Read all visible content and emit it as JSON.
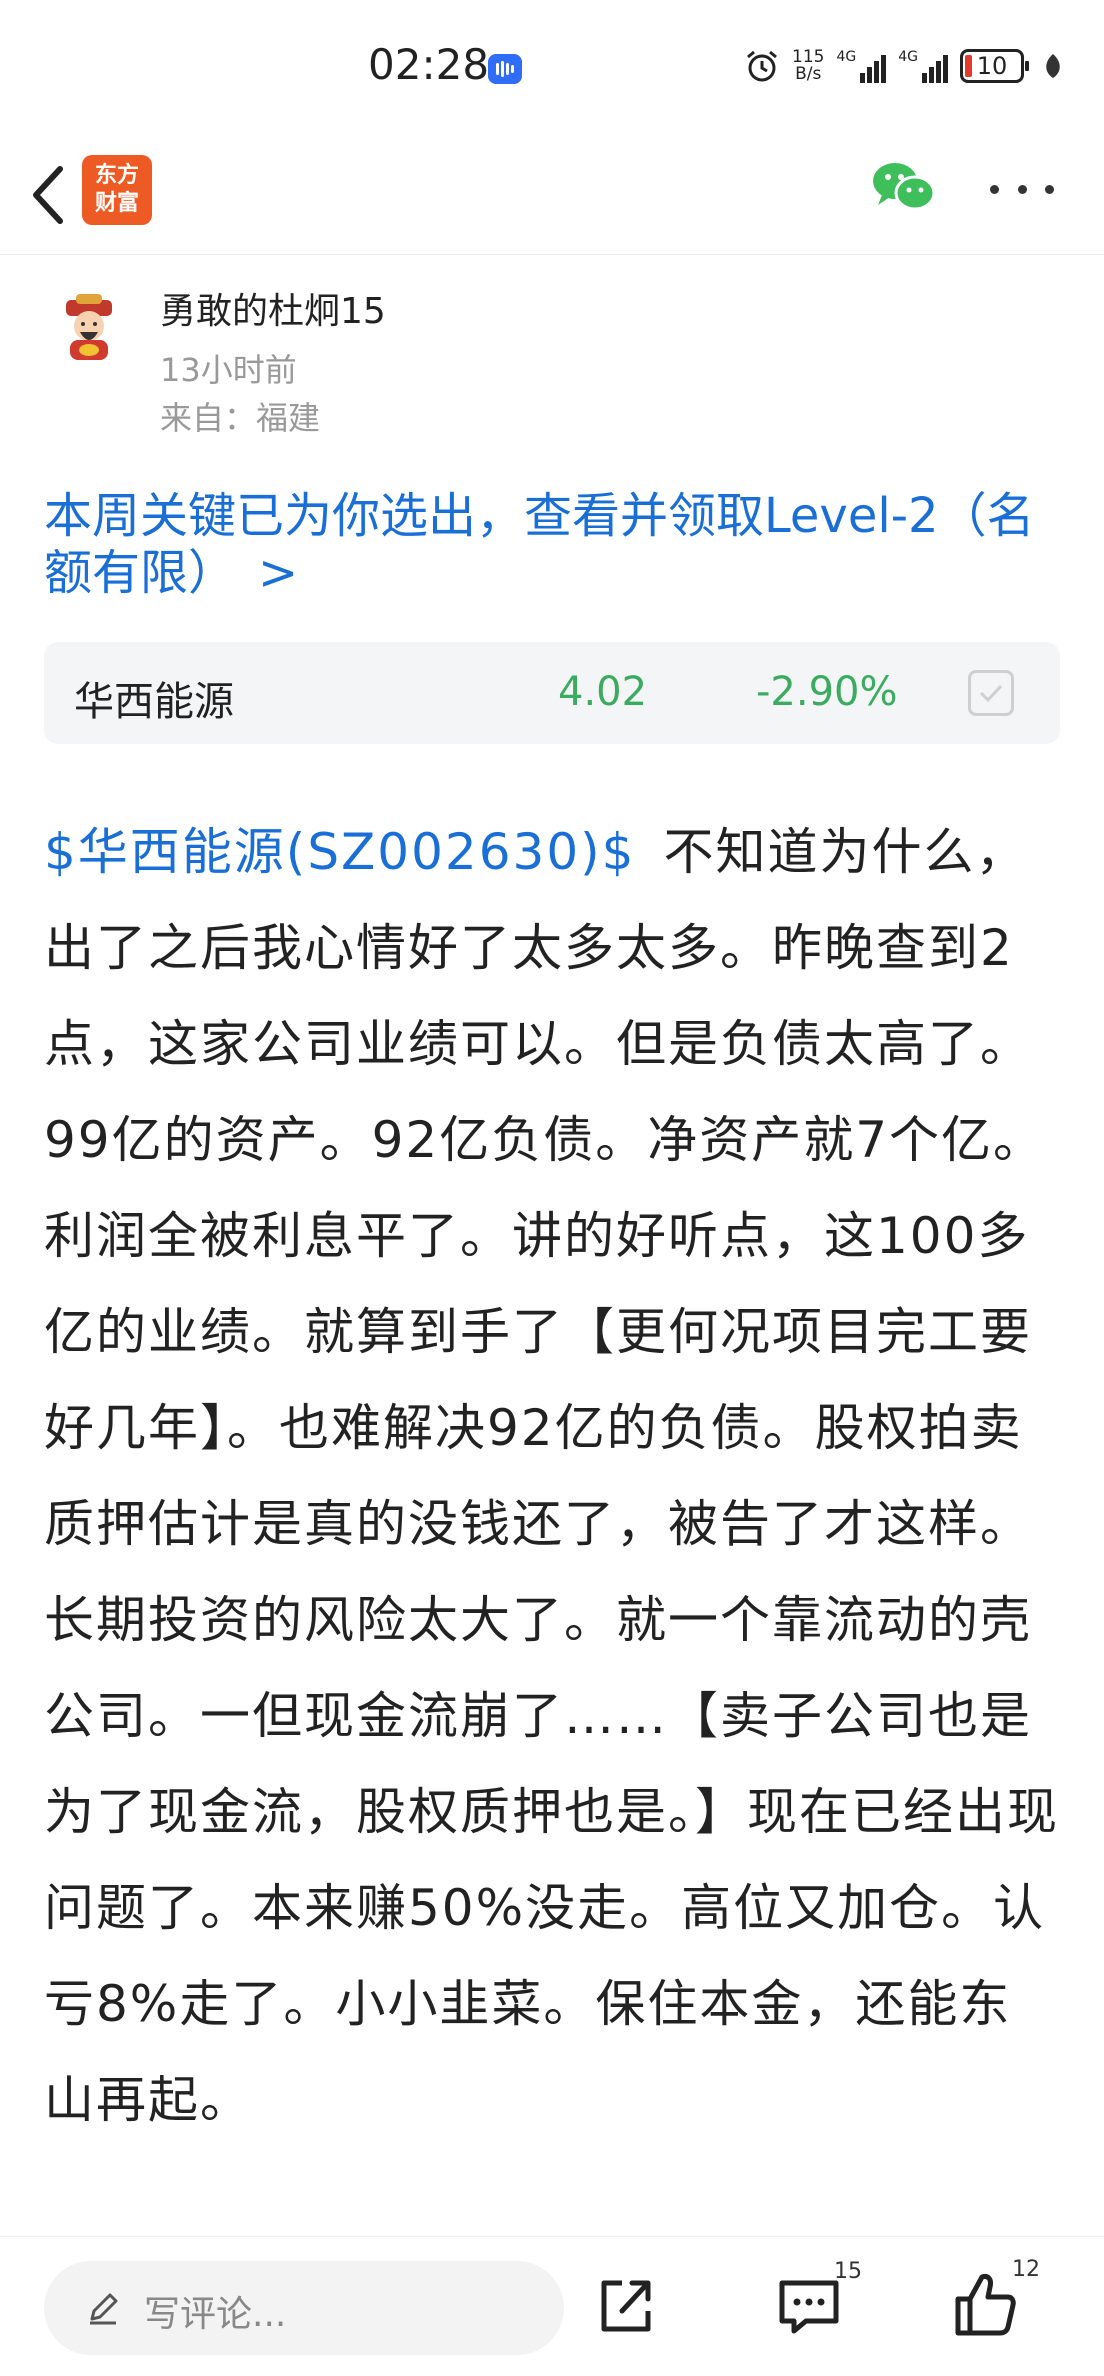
{
  "status_bar": {
    "time": "02:28",
    "net_speed_value": "115",
    "net_speed_unit": "B/s",
    "sim1_label": "4G",
    "sim2_label": "4G",
    "battery": "10"
  },
  "nav": {
    "logo_line1": "东方",
    "logo_line2": "财富",
    "logo_color": "#ee5a24"
  },
  "author": {
    "name": "勇敢的杜炯15",
    "time": "13小时前",
    "location": "来自：福建"
  },
  "promo": {
    "text": "本周关键已为你选出，查看并领取Level-2（名额有限）",
    "arrow": ">",
    "color": "#1a6fd6"
  },
  "stock_card": {
    "name": "华西能源",
    "price": "4.02",
    "change": "-2.90%",
    "change_color": "#3bab5f"
  },
  "post": {
    "stock_link": "$华西能源(SZ002630)$",
    "body": "不知道为什么，出了之后我心情好了太多太多。昨晚查到2点，这家公司业绩可以。但是负债太高了。99亿的资产。92亿负债。净资产就7个亿。利润全被利息平了。讲的好听点，这100多亿的业绩。就算到手了【更何况项目完工要好几年】。也难解决92亿的负债。股权拍卖质押估计是真的没钱还了，被告了才这样。长期投资的风险太大了。就一个靠流动的壳公司。一但现金流崩了……【卖子公司也是为了现金流，股权质押也是。】现在已经出现问题了。本来赚50%没走。高位又加仓。认亏8%走了。小小韭菜。保住本金，还能东山再起。"
  },
  "bottom_bar": {
    "comment_placeholder": "写评论...",
    "comment_count": "15",
    "like_count": "12"
  }
}
